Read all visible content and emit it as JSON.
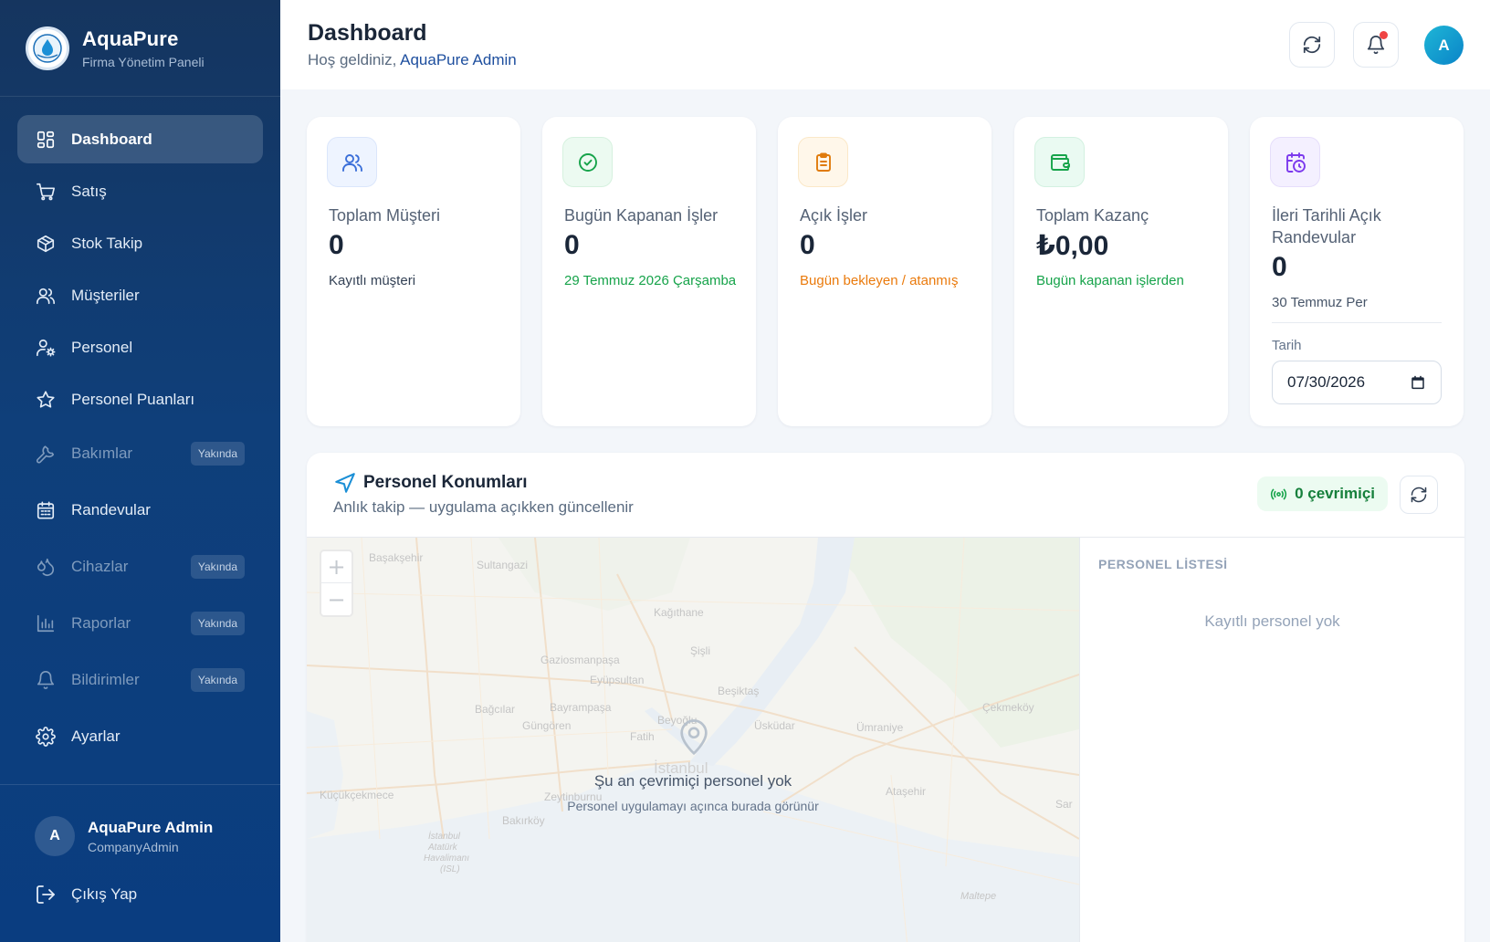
{
  "brand": {
    "title": "AquaPure",
    "subtitle": "Firma Yönetim Paneli"
  },
  "nav": {
    "items": [
      {
        "label": "Dashboard",
        "icon": "dashboard-icon",
        "active": true
      },
      {
        "label": "Satış",
        "icon": "cart-icon"
      },
      {
        "label": "Stok Takip",
        "icon": "package-icon"
      },
      {
        "label": "Müşteriler",
        "icon": "users-icon"
      },
      {
        "label": "Personel",
        "icon": "user-cog-icon"
      },
      {
        "label": "Personel Puanları",
        "icon": "star-icon"
      },
      {
        "label": "Bakımlar",
        "icon": "wrench-icon",
        "badge": "Yakında"
      },
      {
        "label": "Randevular",
        "icon": "calendar-icon"
      },
      {
        "label": "Cihazlar",
        "icon": "droplets-icon",
        "badge": "Yakında"
      },
      {
        "label": "Raporlar",
        "icon": "bar-chart-icon",
        "badge": "Yakında"
      },
      {
        "label": "Bildirimler",
        "icon": "bell-icon",
        "badge": "Yakında"
      },
      {
        "label": "Ayarlar",
        "icon": "gear-icon"
      }
    ]
  },
  "user": {
    "initial": "A",
    "name": "AquaPure Admin",
    "role": "CompanyAdmin"
  },
  "logout_label": "Çıkış Yap",
  "header": {
    "title": "Dashboard",
    "welcome_prefix": "Hoş geldiniz,",
    "welcome_name": "AquaPure Admin",
    "avatar_initial": "A",
    "has_notification": true
  },
  "stats": {
    "customers": {
      "label": "Toplam Müşteri",
      "value": "0",
      "sub": "Kayıtlı müşteri",
      "sub_color": "#334155"
    },
    "closed_today": {
      "label": "Bugün Kapanan İşler",
      "value": "0",
      "sub": "29 Temmuz 2026 Çarşamba",
      "sub_color": "#16a34a"
    },
    "open_jobs": {
      "label": "Açık İşler",
      "value": "0",
      "sub": "Bugün bekleyen / atanmış",
      "sub_color": "#ea7a0c"
    },
    "earnings": {
      "label": "Toplam Kazanç",
      "value": "₺0,00",
      "sub": "Bugün kapanan işlerden",
      "sub_color": "#16a34a"
    },
    "future_appointments": {
      "label": "İleri Tarihli Açık Randevular",
      "value": "0",
      "sub": "30 Temmuz Per",
      "sub_color": "#475569",
      "date_label": "Tarih",
      "date_value": "07/30/2026"
    }
  },
  "locations": {
    "title": "Personel Konumları",
    "subtitle": "Anlık takip — uygulama açıkken güncellenir",
    "online_label": "0 çevrimiçi",
    "map_empty_title": "Şu an çevrimiçi personel yok",
    "map_empty_sub": "Personel uygulamayı açınca burada görünür",
    "list_header": "PERSONEL LİSTESİ",
    "list_empty": "Kayıtlı personel yok",
    "map_labels": [
      "Başakşehir",
      "Sultangazi",
      "Kağıthane",
      "Şişli",
      "Gaziosmanpaşa",
      "Eyüpsultan",
      "Bağcılar",
      "Bayrampaşa",
      "Güngören",
      "Beşiktaş",
      "Üsküdar",
      "Fatih",
      "Ümraniye",
      "Çekmeköy",
      "Küçükçekmece",
      "Bakırköy",
      "Ataşehir",
      "İstanbul",
      "İstanbul Atatürk Havalimanı (ISL)",
      "Zeytinburnu",
      "Beyoğlu",
      "Maltepe",
      "Sarıyer"
    ]
  },
  "colors": {
    "sidebar": "#0f3f7a",
    "accent": "#1d4e9e",
    "success": "#16a34a",
    "warning": "#ea7a0c"
  }
}
